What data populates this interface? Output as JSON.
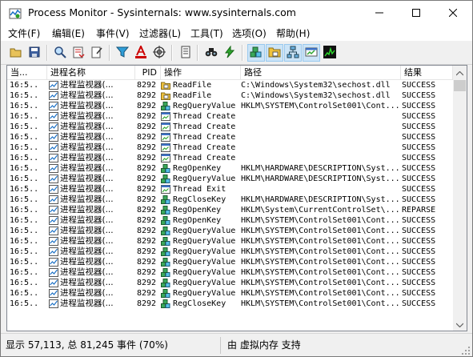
{
  "window": {
    "title": "Process Monitor - Sysinternals: www.sysinternals.com"
  },
  "menu": [
    "文件(F)",
    "编辑(E)",
    "事件(V)",
    "过滤器(L)",
    "工具(T)",
    "选项(O)",
    "帮助(H)"
  ],
  "toolbar": [
    {
      "icon": "open-icon",
      "tooltip": "打开"
    },
    {
      "icon": "save-icon",
      "tooltip": "保存"
    },
    {
      "icon": "magnifier-icon",
      "tooltip": "捕获"
    },
    {
      "icon": "autoscroll-icon",
      "tooltip": "自动滚动"
    },
    {
      "icon": "clear-icon",
      "tooltip": "清除"
    },
    {
      "icon": "filter-icon",
      "tooltip": "过滤器"
    },
    {
      "icon": "highlight-icon",
      "tooltip": "高亮"
    },
    {
      "icon": "target-icon",
      "tooltip": "包含进程"
    },
    {
      "icon": "process-tree-icon",
      "tooltip": "进程树"
    },
    {
      "icon": "find-icon",
      "tooltip": "查找"
    },
    {
      "icon": "jump-icon",
      "tooltip": "跳转"
    },
    {
      "icon": "registry-activity-icon",
      "tooltip": "注册表活动"
    },
    {
      "icon": "file-activity-icon",
      "tooltip": "文件系统活动"
    },
    {
      "icon": "network-activity-icon",
      "tooltip": "网络活动"
    },
    {
      "icon": "process-activity-icon",
      "tooltip": "进程和线程活动"
    },
    {
      "icon": "profiling-icon",
      "tooltip": "分析事件"
    }
  ],
  "columns": {
    "time": "当...",
    "process": "进程名称",
    "pid": "PID",
    "operation": "操作",
    "path": "路径",
    "result": "结果"
  },
  "rows": [
    {
      "time": "16:5...",
      "process": "进程监视器(...",
      "pid": "8292",
      "op": "ReadFile",
      "kind": "file",
      "path": "C:\\Windows\\System32\\sechost.dll",
      "result": "SUCCESS"
    },
    {
      "time": "16:5...",
      "process": "进程监视器(...",
      "pid": "8292",
      "op": "ReadFile",
      "kind": "file",
      "path": "C:\\Windows\\System32\\sechost.dll",
      "result": "SUCCESS"
    },
    {
      "time": "16:5...",
      "process": "进程监视器(...",
      "pid": "8292",
      "op": "RegQueryValue",
      "kind": "reg",
      "path": "HKLM\\SYSTEM\\ControlSet001\\Cont...",
      "result": "SUCCESS"
    },
    {
      "time": "16:5...",
      "process": "进程监视器(...",
      "pid": "8292",
      "op": "Thread Create",
      "kind": "thread",
      "path": "",
      "result": "SUCCESS"
    },
    {
      "time": "16:5...",
      "process": "进程监视器(...",
      "pid": "8292",
      "op": "Thread Create",
      "kind": "thread",
      "path": "",
      "result": "SUCCESS"
    },
    {
      "time": "16:5...",
      "process": "进程监视器(...",
      "pid": "8292",
      "op": "Thread Create",
      "kind": "thread",
      "path": "",
      "result": "SUCCESS"
    },
    {
      "time": "16:5...",
      "process": "进程监视器(...",
      "pid": "8292",
      "op": "Thread Create",
      "kind": "thread",
      "path": "",
      "result": "SUCCESS"
    },
    {
      "time": "16:5...",
      "process": "进程监视器(...",
      "pid": "8292",
      "op": "Thread Create",
      "kind": "thread",
      "path": "",
      "result": "SUCCESS"
    },
    {
      "time": "16:5...",
      "process": "进程监视器(...",
      "pid": "8292",
      "op": "RegOpenKey",
      "kind": "reg",
      "path": "HKLM\\HARDWARE\\DESCRIPTION\\Syst...",
      "result": "SUCCESS"
    },
    {
      "time": "16:5...",
      "process": "进程监视器(...",
      "pid": "8292",
      "op": "RegQueryValue",
      "kind": "reg",
      "path": "HKLM\\HARDWARE\\DESCRIPTION\\Syst...",
      "result": "SUCCESS"
    },
    {
      "time": "16:5...",
      "process": "进程监视器(...",
      "pid": "8292",
      "op": "Thread Exit",
      "kind": "thread",
      "path": "",
      "result": "SUCCESS"
    },
    {
      "time": "16:5...",
      "process": "进程监视器(...",
      "pid": "8292",
      "op": "RegCloseKey",
      "kind": "reg",
      "path": "HKLM\\HARDWARE\\DESCRIPTION\\Syst...",
      "result": "SUCCESS"
    },
    {
      "time": "16:5...",
      "process": "进程监视器(...",
      "pid": "8292",
      "op": "RegOpenKey",
      "kind": "reg",
      "path": "HKLM\\System\\CurrentControlSet\\...",
      "result": "REPARSE"
    },
    {
      "time": "16:5...",
      "process": "进程监视器(...",
      "pid": "8292",
      "op": "RegOpenKey",
      "kind": "reg",
      "path": "HKLM\\SYSTEM\\ControlSet001\\Cont...",
      "result": "SUCCESS"
    },
    {
      "time": "16:5...",
      "process": "进程监视器(...",
      "pid": "8292",
      "op": "RegQueryValue",
      "kind": "reg",
      "path": "HKLM\\SYSTEM\\ControlSet001\\Cont...",
      "result": "SUCCESS"
    },
    {
      "time": "16:5...",
      "process": "进程监视器(...",
      "pid": "8292",
      "op": "RegQueryValue",
      "kind": "reg",
      "path": "HKLM\\SYSTEM\\ControlSet001\\Cont...",
      "result": "SUCCESS"
    },
    {
      "time": "16:5...",
      "process": "进程监视器(...",
      "pid": "8292",
      "op": "RegQueryValue",
      "kind": "reg",
      "path": "HKLM\\SYSTEM\\ControlSet001\\Cont...",
      "result": "SUCCESS"
    },
    {
      "time": "16:5...",
      "process": "进程监视器(...",
      "pid": "8292",
      "op": "RegQueryValue",
      "kind": "reg",
      "path": "HKLM\\SYSTEM\\ControlSet001\\Cont...",
      "result": "SUCCESS"
    },
    {
      "time": "16:5...",
      "process": "进程监视器(...",
      "pid": "8292",
      "op": "RegQueryValue",
      "kind": "reg",
      "path": "HKLM\\SYSTEM\\ControlSet001\\Cont...",
      "result": "SUCCESS"
    },
    {
      "time": "16:5...",
      "process": "进程监视器(...",
      "pid": "8292",
      "op": "RegQueryValue",
      "kind": "reg",
      "path": "HKLM\\SYSTEM\\ControlSet001\\Cont...",
      "result": "SUCCESS"
    },
    {
      "time": "16:5...",
      "process": "进程监视器(...",
      "pid": "8292",
      "op": "RegQueryValue",
      "kind": "reg",
      "path": "HKLM\\SYSTEM\\ControlSet001\\Cont...",
      "result": "SUCCESS"
    },
    {
      "time": "16:5...",
      "process": "进程监视器(...",
      "pid": "8292",
      "op": "RegCloseKey",
      "kind": "reg",
      "path": "HKLM\\SYSTEM\\ControlSet001\\Cont...",
      "result": "SUCCESS"
    }
  ],
  "status": {
    "events": "显示 57,113, 总 81,245 事件 (70%)",
    "memory": "由 虚拟内存 支持"
  },
  "colors": {
    "selection": "#cce4f7",
    "registry": "#2f7f2f",
    "file": "#d9a51e",
    "thread": "#a83a9a"
  }
}
